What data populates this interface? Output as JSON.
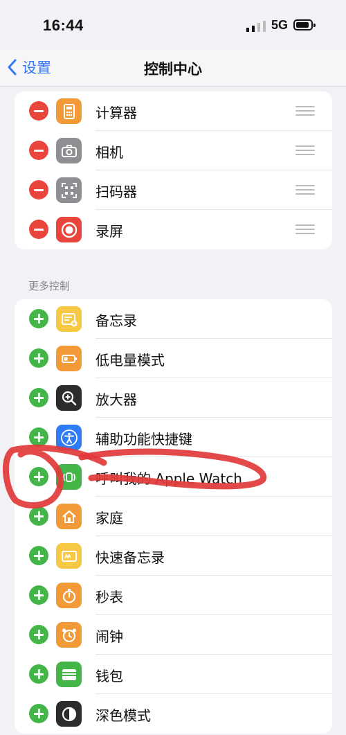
{
  "status_bar": {
    "time": "16:44",
    "network": "5G"
  },
  "nav": {
    "back_label": "设置",
    "title": "控制中心"
  },
  "included_controls": [
    {
      "label": "计算器",
      "icon": "calculator-icon",
      "color": "#f19a37"
    },
    {
      "label": "相机",
      "icon": "camera-icon",
      "color": "#8e8e93"
    },
    {
      "label": "扫码器",
      "icon": "qr-scanner-icon",
      "color": "#8e8e93"
    },
    {
      "label": "录屏",
      "icon": "screen-record-icon",
      "color": "#e9453d"
    }
  ],
  "more_controls": {
    "header": "更多控制",
    "items": [
      {
        "label": "备忘录",
        "icon": "notes-icon",
        "color": "#f7c844"
      },
      {
        "label": "低电量模式",
        "icon": "battery-icon",
        "color": "#f19a37"
      },
      {
        "label": "放大器",
        "icon": "magnifier-icon",
        "color": "#2c2c2e"
      },
      {
        "label": "辅助功能快捷键",
        "icon": "accessibility-icon",
        "color": "#2f7cf6"
      },
      {
        "label": "呼叫我的 Apple Watch",
        "icon": "watch-ping-icon",
        "color": "#43b549"
      },
      {
        "label": "家庭",
        "icon": "home-icon",
        "color": "#f19a37"
      },
      {
        "label": "快速备忘录",
        "icon": "quick-note-icon",
        "color": "#f7c844"
      },
      {
        "label": "秒表",
        "icon": "stopwatch-icon",
        "color": "#f19a37"
      },
      {
        "label": "闹钟",
        "icon": "alarm-icon",
        "color": "#f19a37"
      },
      {
        "label": "钱包",
        "icon": "wallet-icon",
        "color": "#43b549"
      },
      {
        "label": "深色模式",
        "icon": "dark-mode-icon",
        "color": "#2c2c2e"
      }
    ]
  },
  "colors": {
    "accent": "#3478f6",
    "remove": "#e9453d",
    "add": "#43b549",
    "annotation": "#e23a3a"
  }
}
